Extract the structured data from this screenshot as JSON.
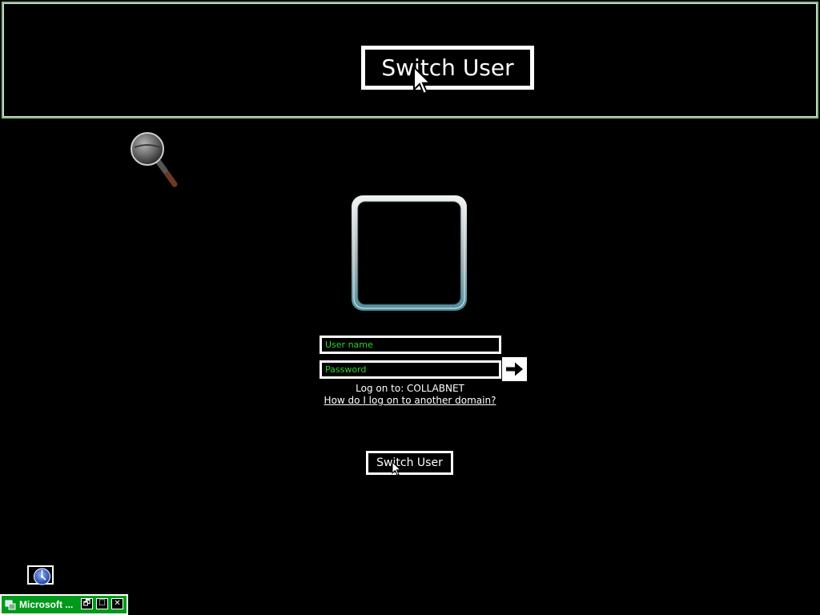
{
  "magnifier": {
    "switch_user_label": "Switch User"
  },
  "login": {
    "username_placeholder": "User name",
    "password_placeholder": "Password",
    "logon_to": "Log on to: COLLABNET",
    "other_domain_link": "How do I log on to another domain?",
    "switch_user_label": "Switch User"
  },
  "taskbar": {
    "window_title": "Microsoft ...",
    "restore_glyph": "🗗",
    "maximize_glyph": "☐",
    "close_glyph": "✕"
  },
  "icons": {
    "magnifier": "magnifier-icon",
    "user_tile": "user-tile-frame",
    "arrow": "arrow-right-icon",
    "ease_of_access": "ease-of-access-icon"
  },
  "colors": {
    "field_text": "#2cd42c",
    "taskbar_green": "#009a1a",
    "magnifier_border": "#8fb98f"
  }
}
